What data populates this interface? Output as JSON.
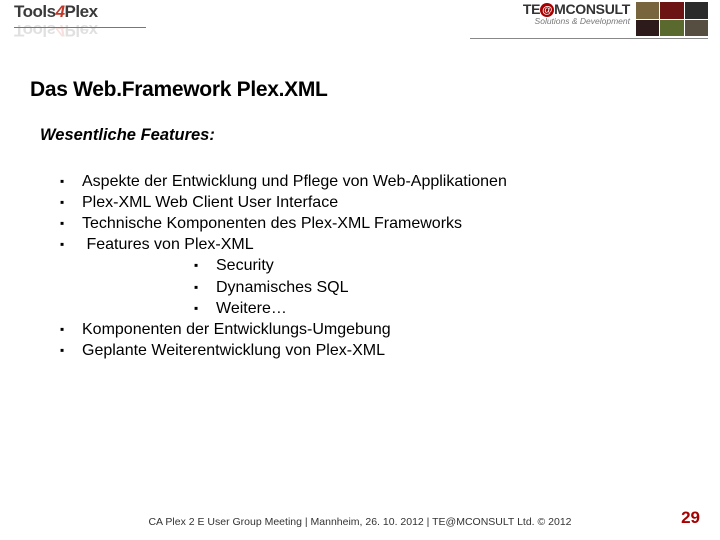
{
  "header": {
    "left_logo_a": "Tools",
    "left_logo_four": "4",
    "left_logo_b": "Plex",
    "right_brand_a": "TE",
    "right_brand_at": "@",
    "right_brand_b": "MCONSULT",
    "right_sub": "Solutions & Development"
  },
  "title": "Das Web.Framework Plex.XML",
  "subtitle": "Wesentliche Features:",
  "bullets": {
    "b1": "Aspekte der Entwicklung und Pflege von Web-Applikationen",
    "b2": "Plex-XML Web Client User Interface",
    "b3": "Technische Komponenten des Plex-XML Frameworks",
    "b4": "Features von Plex-XML",
    "b4a": "Security",
    "b4b": "Dynamisches SQL",
    "b4c": "Weitere…",
    "b5": "Komponenten der Entwicklungs-Umgebung",
    "b6": "Geplante Weiterentwicklung von Plex-XML"
  },
  "footer": {
    "text": "CA Plex 2 E User Group Meeting | Mannheim, 26. 10. 2012 | TE@MCONSULT Ltd. © 2012",
    "page": "29"
  }
}
